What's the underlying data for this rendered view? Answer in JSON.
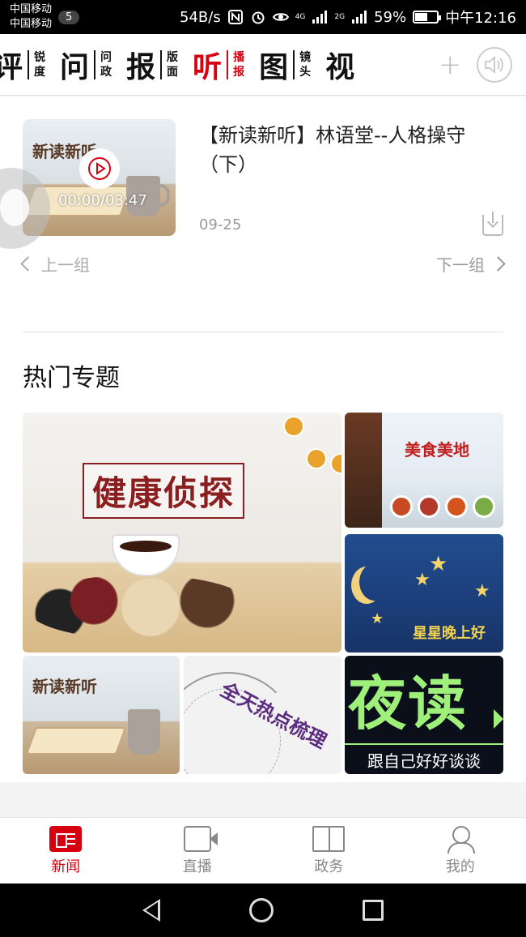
{
  "status_bar": {
    "carrier_1": "中国移动",
    "carrier_2": "中国移动",
    "sim_badge": "5",
    "network_speed": "54B/s",
    "signal_1": "4G",
    "signal_2": "2G",
    "battery_percent": "59%",
    "battery_level": 0.59,
    "time": "中午12:16"
  },
  "channels": [
    {
      "big": "评",
      "small_1": "锐",
      "small_2": "度"
    },
    {
      "big": "问",
      "small_1": "问",
      "small_2": "政"
    },
    {
      "big": "报",
      "small_1": "版",
      "small_2": "面"
    },
    {
      "big": "听",
      "small_1": "播",
      "small_2": "报"
    },
    {
      "big": "图",
      "small_1": "镜",
      "small_2": "头"
    },
    {
      "big": "视",
      "small_1": "",
      "small_2": ""
    }
  ],
  "active_channel": "听",
  "audio": {
    "thumb_title": "新读新听",
    "duration": "00:00/03:47",
    "title": "【新读新听】林语堂--人格操守（下）",
    "date": "09-25",
    "prev_label": "上一组",
    "next_label": "下一组"
  },
  "topics": {
    "section_title": "热门专题",
    "items": [
      {
        "label": "健康侦探"
      },
      {
        "label": "美食美地"
      },
      {
        "label": "星星晚上好"
      },
      {
        "label": "新读新听"
      },
      {
        "label": "全天热点梳理"
      },
      {
        "label": "夜读",
        "sub": "跟自己好好谈谈"
      }
    ]
  },
  "tabbar": {
    "items": [
      {
        "label": "新闻",
        "icon": "news-icon",
        "active": true
      },
      {
        "label": "直播",
        "icon": "video-icon",
        "active": false
      },
      {
        "label": "政务",
        "icon": "book-icon",
        "active": false
      },
      {
        "label": "我的",
        "icon": "user-icon",
        "active": false
      }
    ],
    "accent_color": "#d6000f"
  }
}
